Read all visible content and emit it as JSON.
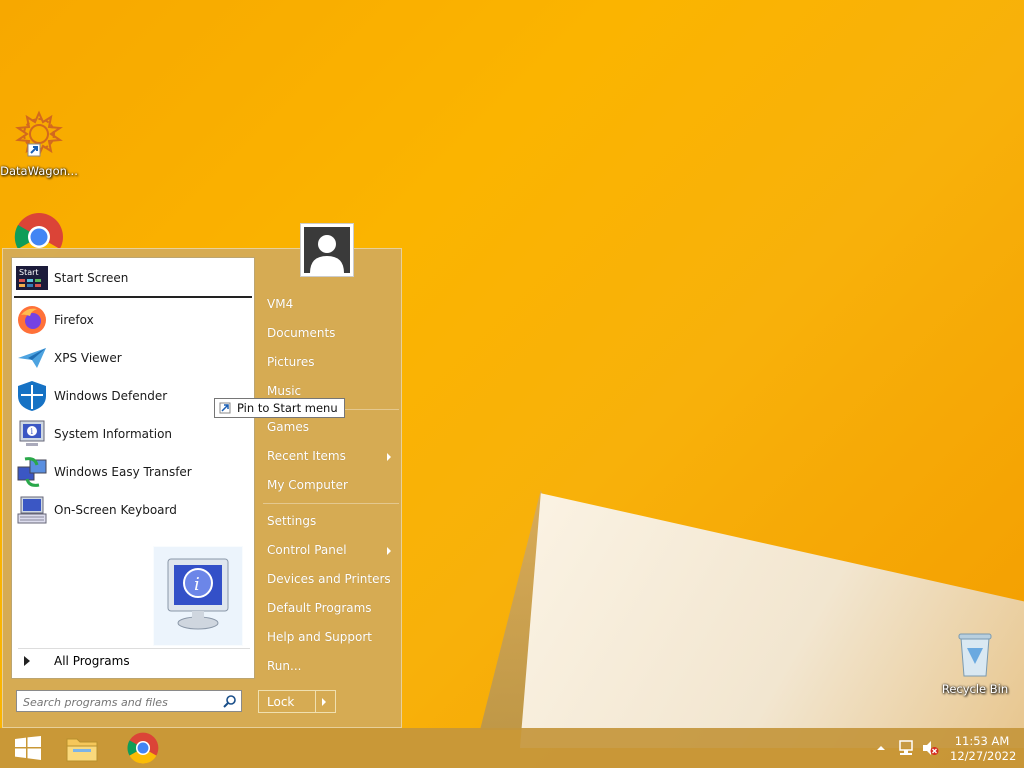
{
  "desktop": {
    "icons": [
      {
        "label": "DataWagon..."
      },
      {
        "label": "Recycle Bin"
      }
    ]
  },
  "start_menu": {
    "pinned": {
      "label": "Start Screen",
      "icon_text": "Start"
    },
    "programs": [
      {
        "label": "Firefox",
        "icon": "firefox-icon"
      },
      {
        "label": "XPS Viewer",
        "icon": "xps-viewer-icon"
      },
      {
        "label": "Windows Defender",
        "icon": "shield-icon"
      },
      {
        "label": "System Information",
        "icon": "system-information-icon"
      },
      {
        "label": "Windows Easy Transfer",
        "icon": "easy-transfer-icon"
      },
      {
        "label": "On-Screen Keyboard",
        "icon": "keyboard-icon"
      }
    ],
    "all_programs": "All Programs",
    "search_placeholder": "Search programs and files",
    "drag_tooltip": "Pin to Start menu",
    "right": [
      {
        "label": "VM4"
      },
      {
        "label": "Documents"
      },
      {
        "label": "Pictures"
      },
      {
        "label": "Music"
      },
      {
        "label": "Games"
      },
      {
        "label": "Recent Items",
        "submenu": true
      },
      {
        "label": "My Computer"
      },
      {
        "label": "Settings"
      },
      {
        "label": "Control Panel",
        "submenu": true
      },
      {
        "label": "Devices and Printers"
      },
      {
        "label": "Default Programs"
      },
      {
        "label": "Help and Support"
      },
      {
        "label": "Run..."
      }
    ],
    "lock_label": "Lock"
  },
  "taskbar": {
    "clock_time": "11:53 AM",
    "clock_date": "12/27/2022",
    "apps": [
      "windows-start-icon",
      "file-explorer-icon",
      "chrome-icon"
    ]
  },
  "colors": {
    "accent": "#c8963c",
    "wallpaper": "#f8b10a"
  }
}
